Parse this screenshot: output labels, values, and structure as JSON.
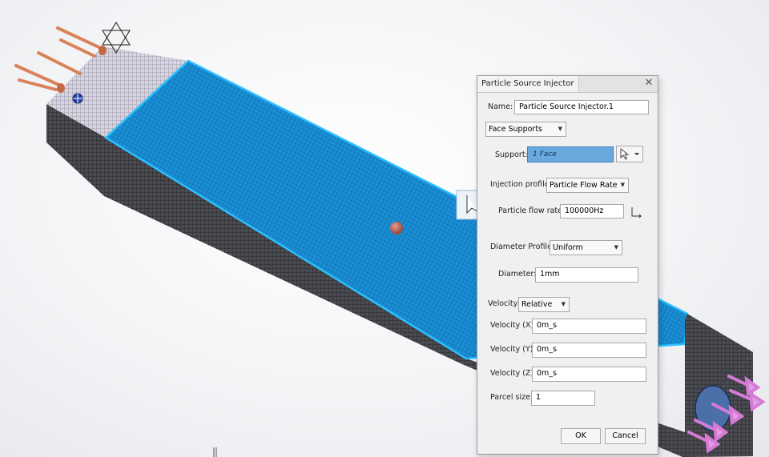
{
  "dialog": {
    "title": "Particle Source Injector",
    "close_glyph": "✕",
    "name_label": "Name:",
    "name_value": "Particle Source Injector.1",
    "support_mode": "Face Supports",
    "support_label": "Support:",
    "support_value": "1 Face",
    "injection_profile_label": "Injection profile:",
    "injection_profile_value": "Particle Flow Rate",
    "flow_rate_label": "Particle flow rate:",
    "flow_rate_value": "100000Hz",
    "diameter_profile_label": "Diameter Profile:",
    "diameter_profile_value": "Uniform",
    "diameter_label": "Diameter:",
    "diameter_value": "1mm",
    "velocity_label": "Velocity:",
    "velocity_value": "Relative",
    "velocity_x_label": "Velocity (X):",
    "velocity_x_value": "0m_s",
    "velocity_y_label": "Velocity (Y):",
    "velocity_y_value": "0m_s",
    "velocity_z_label": "Velocity (Z):",
    "velocity_z_value": "0m_s",
    "parcel_size_label": "Parcel size:",
    "parcel_size_value": "1",
    "ok_label": "OK",
    "cancel_label": "Cancel"
  },
  "icons": {
    "selection_cursor": "cursor-icon",
    "dropdown": "chevron-down-icon",
    "axis": "axis-icon"
  },
  "colors": {
    "selected_face": "#1fa2e6",
    "mesh_dark": "#3e3f44",
    "mesh_light": "#c9c8d6",
    "injector_rods": "#d9825a",
    "outlet_arrows": "#d77ad6",
    "support_highlight": "#6aa9dd"
  }
}
